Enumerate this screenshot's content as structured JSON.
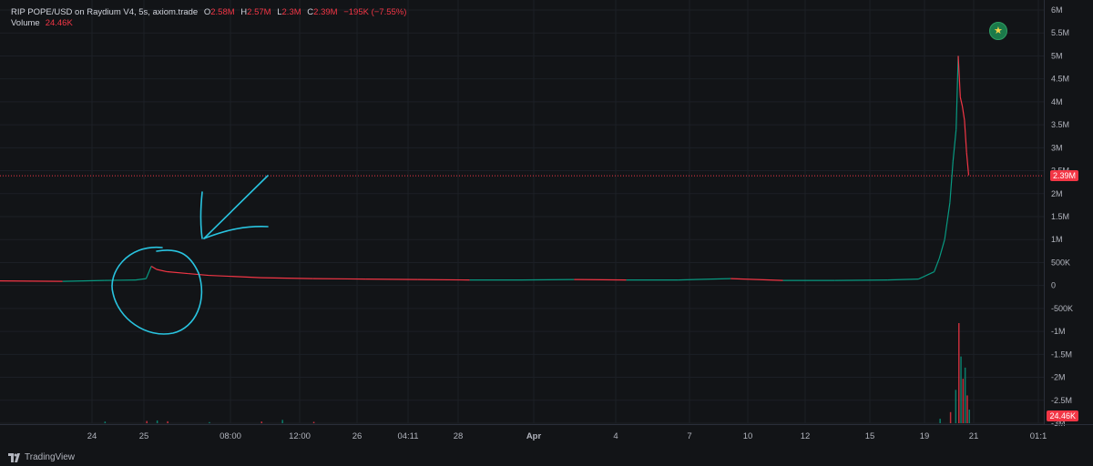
{
  "legend": {
    "symbol": "RIP POPE/USD on Raydium V4, 5s, axiom.trade",
    "o_label": "O",
    "o_value": "2.58M",
    "h_label": "H",
    "h_value": "2.57M",
    "l_label": "L",
    "l_value": "2.3M",
    "c_label": "C",
    "c_value": "2.39M",
    "change": "−195K (−7.55%)",
    "volume_label": "Volume",
    "volume_value": "24.46K"
  },
  "price_tag": "2.39M",
  "volume_tag": "24.46K",
  "branding": "TradingView",
  "colors": {
    "background": "#121417",
    "up": "#089981",
    "down": "#f23645",
    "annotation": "#29c4e0",
    "grid": "#1c1f26",
    "text": "#b2b5be"
  },
  "chart_data": {
    "type": "line",
    "y_axis": {
      "ticks": [
        "6M",
        "5.5M",
        "5M",
        "4.5M",
        "4M",
        "3.5M",
        "3M",
        "2.5M",
        "2M",
        "1.5M",
        "1M",
        "500K",
        "0",
        "-500K",
        "-1M",
        "-1.5M",
        "-2M",
        "-2.5M",
        "-3M"
      ],
      "values": [
        6000000,
        5500000,
        5000000,
        4500000,
        4000000,
        3500000,
        3000000,
        2500000,
        2000000,
        1500000,
        1000000,
        500000,
        0,
        -500000,
        -1000000,
        -1500000,
        -2000000,
        -2500000,
        -3000000
      ],
      "range": [
        -3000000,
        6000000
      ]
    },
    "x_axis": {
      "ticks": [
        "24",
        "25",
        "08:00",
        "12:00",
        "26",
        "04:11",
        "28",
        "Apr",
        "4",
        "7",
        "10",
        "12",
        "15",
        "19",
        "21",
        "01:1"
      ],
      "bold": [
        "Apr"
      ]
    },
    "price_series": {
      "name": "",
      "x": [
        0,
        0.06,
        0.1,
        0.13,
        0.14,
        0.145,
        0.15,
        0.16,
        0.18,
        0.2,
        0.25,
        0.3,
        0.35,
        0.4,
        0.45,
        0.5,
        0.55,
        0.6,
        0.65,
        0.7,
        0.75,
        0.8,
        0.85,
        0.88,
        0.895,
        0.9,
        0.905,
        0.91,
        0.913,
        0.916,
        0.918,
        0.92,
        0.922,
        0.924,
        0.926,
        0.928
      ],
      "y": [
        100000,
        90000,
        110000,
        120000,
        150000,
        420000,
        350000,
        300000,
        260000,
        220000,
        170000,
        150000,
        140000,
        130000,
        120000,
        120000,
        130000,
        120000,
        120000,
        150000,
        110000,
        110000,
        120000,
        140000,
        300000,
        600000,
        1000000,
        1800000,
        2700000,
        3400000,
        5000000,
        4100000,
        3900000,
        3600000,
        2900000,
        2400000
      ]
    },
    "last_price": 2390000,
    "volume_series": {
      "name": "Volume",
      "x": [
        0.1,
        0.14,
        0.15,
        0.16,
        0.2,
        0.25,
        0.27,
        0.3,
        0.9,
        0.91,
        0.915,
        0.918,
        0.92,
        0.922,
        0.924,
        0.926,
        0.928
      ],
      "y": [
        3000,
        4000,
        5000,
        3500,
        2000,
        3000,
        6000,
        2500,
        8000,
        20000,
        60000,
        180000,
        120000,
        80000,
        100000,
        50000,
        24460
      ]
    },
    "grid": true
  }
}
